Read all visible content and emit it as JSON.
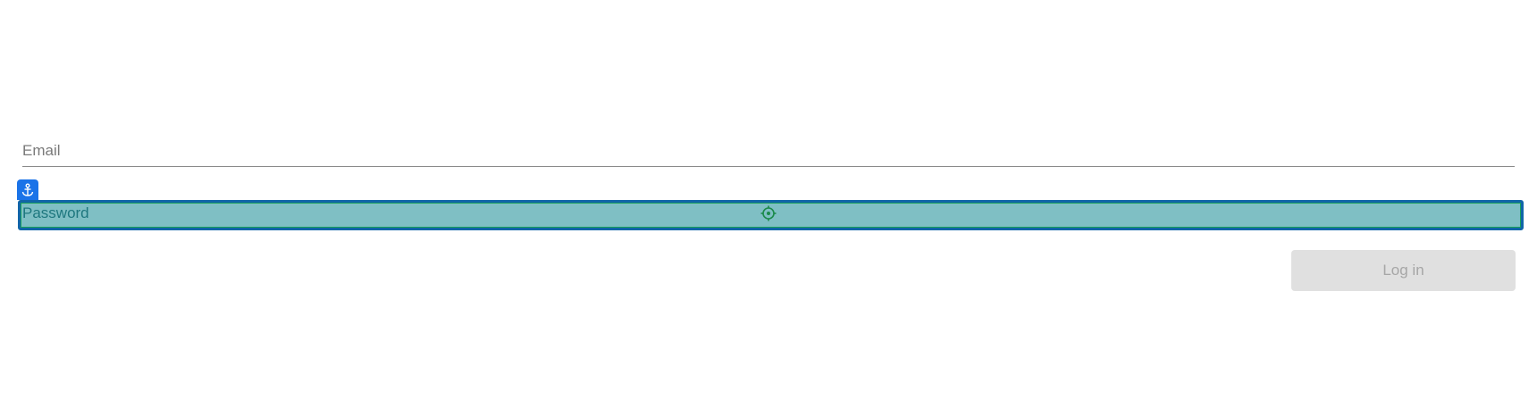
{
  "form": {
    "email": {
      "placeholder": "Email",
      "value": ""
    },
    "password": {
      "placeholder": "Password",
      "value": ""
    },
    "login_button": {
      "label": "Log in",
      "disabled": true
    }
  },
  "overlay": {
    "anchor_icon": "anchor-icon",
    "target_icon": "crosshair-target-icon",
    "highlight_color": "#1165a8",
    "fill_color": "#80b9bf",
    "badge_color": "#1a73e8"
  }
}
